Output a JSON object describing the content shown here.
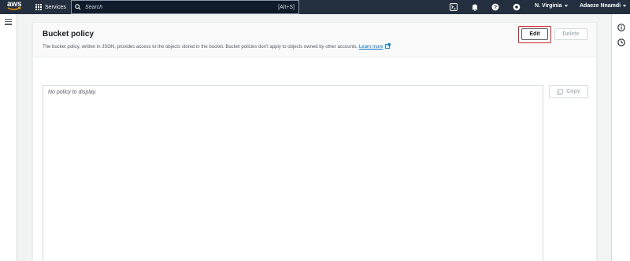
{
  "topbar": {
    "logo_text": "aws",
    "services_label": "Services",
    "search_placeholder": "Search",
    "search_shortcut": "[Alt+S]",
    "region_label": "N. Virginia",
    "user_label": "Adaeze Nnamdi"
  },
  "panel": {
    "title": "Bucket policy",
    "description": "The bucket policy, written in JSON, provides access to the objects stored in the bucket. Bucket policies don't apply to objects owned by other accounts.",
    "learn_more": "Learn more",
    "edit_label": "Edit",
    "delete_label": "Delete",
    "copy_label": "Copy",
    "empty_text": "No policy to display."
  },
  "colors": {
    "nav_bg": "#232f3e",
    "link": "#0073bb",
    "highlight": "#d1232a",
    "aws_smile": "#ff9900"
  },
  "icons": [
    "grid-icon",
    "search-icon",
    "cloudshell-icon",
    "bell-icon",
    "help-icon",
    "gear-icon",
    "hamburger-icon",
    "external-link-icon",
    "copy-icon",
    "info-icon",
    "clock-icon"
  ]
}
